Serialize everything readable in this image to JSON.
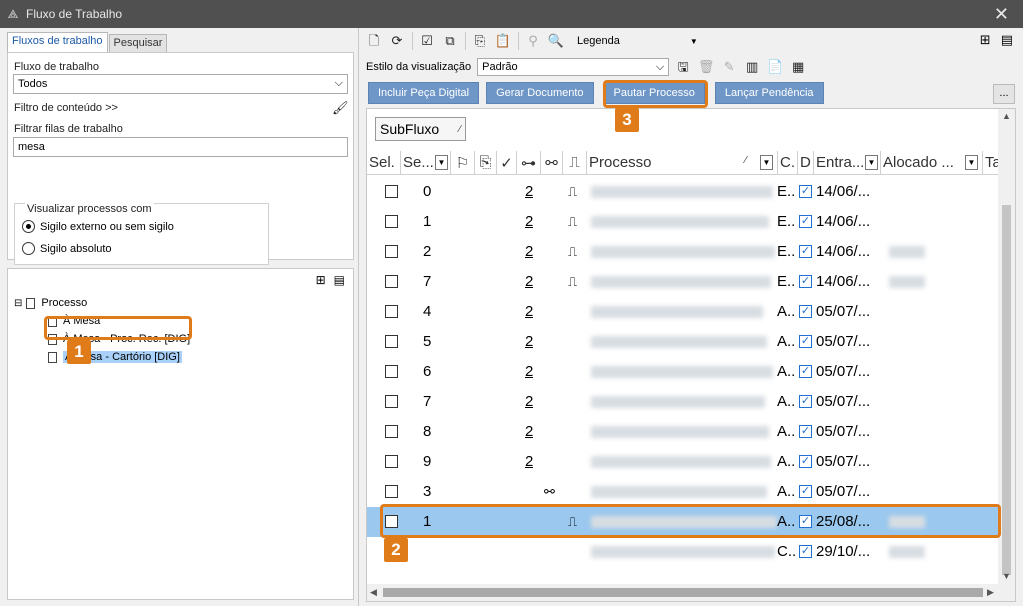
{
  "window": {
    "title": "Fluxo de Trabalho",
    "close_glyph": "✕",
    "app_icon": "workflow-icon"
  },
  "left": {
    "tabs": [
      {
        "label": "Fluxos de trabalho",
        "active": true
      },
      {
        "label": "Pesquisar",
        "active": false
      }
    ],
    "fluxo_label": "Fluxo de trabalho",
    "fluxo_value": "Todos",
    "filtro_conteudo": "Filtro de conteúdo >>",
    "filtrar_filas_label": "Filtrar filas de trabalho",
    "filtrar_filas_value": "mesa",
    "visualizar_label": "Visualizar processos com",
    "radio_options": [
      {
        "label": "Sigilo externo ou sem sigilo",
        "selected": true
      },
      {
        "label": "Sigilo absoluto",
        "selected": false
      }
    ],
    "tree": {
      "root": "Processo",
      "children": [
        "À Mesa",
        "À Mesa - Proc. Rec. [DIG]",
        "À Mesa - Cartório [DIG]"
      ],
      "selected_index": 2
    }
  },
  "toolbar": {
    "legenda": "Legenda"
  },
  "view": {
    "label": "Estilo da visualização",
    "value": "Padrão"
  },
  "actions": [
    "Incluir Peça Digital",
    "Gerar Documento",
    "Pautar Processo",
    "Lançar Pendência"
  ],
  "more_label": "...",
  "grid": {
    "subfluxo": "SubFluxo",
    "columns": [
      "Sel.",
      "Se...",
      "Processo",
      "C.",
      "D",
      "Entra...",
      "Alocado ...",
      "Ta"
    ],
    "rows": [
      {
        "seq": "0",
        "count": "2",
        "pin": true,
        "link": false,
        "c": "E..",
        "date": "14/06/...",
        "alloc": false
      },
      {
        "seq": "1",
        "count": "2",
        "pin": true,
        "link": false,
        "c": "E..",
        "date": "14/06/...",
        "alloc": false
      },
      {
        "seq": "2",
        "count": "2",
        "pin": true,
        "link": false,
        "c": "E..",
        "date": "14/06/...",
        "alloc": true
      },
      {
        "seq": "7",
        "count": "2",
        "pin": true,
        "link": false,
        "c": "E..",
        "date": "14/06/...",
        "alloc": true
      },
      {
        "seq": "4",
        "count": "2",
        "pin": false,
        "link": false,
        "c": "A..",
        "date": "05/07/...",
        "alloc": false
      },
      {
        "seq": "5",
        "count": "2",
        "pin": false,
        "link": false,
        "c": "A..",
        "date": "05/07/...",
        "alloc": false
      },
      {
        "seq": "6",
        "count": "2",
        "pin": false,
        "link": false,
        "c": "A..",
        "date": "05/07/...",
        "alloc": false
      },
      {
        "seq": "7",
        "count": "2",
        "pin": false,
        "link": false,
        "c": "A..",
        "date": "05/07/...",
        "alloc": false
      },
      {
        "seq": "8",
        "count": "2",
        "pin": false,
        "link": false,
        "c": "A..",
        "date": "05/07/...",
        "alloc": false
      },
      {
        "seq": "9",
        "count": "2",
        "pin": false,
        "link": false,
        "c": "A..",
        "date": "05/07/...",
        "alloc": false
      },
      {
        "seq": "3",
        "count": "",
        "pin": false,
        "link": true,
        "c": "A..",
        "date": "05/07/...",
        "alloc": false
      },
      {
        "seq": "1",
        "count": "",
        "pin": true,
        "link": false,
        "c": "A..",
        "date": "25/08/...",
        "alloc": true,
        "selected": true
      },
      {
        "seq": "",
        "count": "",
        "pin": false,
        "link": false,
        "c": "C..",
        "date": "29/10/...",
        "alloc": true,
        "nocheck": true
      }
    ]
  },
  "callouts": [
    "1",
    "2",
    "3"
  ],
  "colors": {
    "accent": "#e07b1a",
    "action_button": "#6e96c6",
    "selection": "#9bc8ee",
    "titlebar": "#505050"
  }
}
